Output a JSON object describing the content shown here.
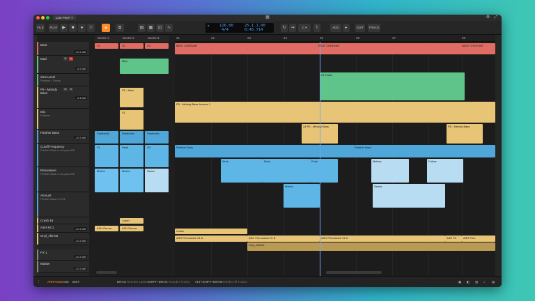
{
  "window": {
    "title": "Lost Peer*",
    "logo": "▦"
  },
  "toolbar": {
    "file": "FILE",
    "play": "PLAY",
    "play_icon": "▶",
    "stop_icon": "■",
    "record_icon": "●",
    "add_icon": "+",
    "tempo": "126.00",
    "signature": "4/4",
    "position": "25.1.1.00",
    "time": "0:45.714",
    "key": "C",
    "adg": "ADG",
    "edit": "EDIT",
    "track": "TRACK"
  },
  "scenes": [
    "Scene 1",
    "Scene 2",
    "Scene 3"
  ],
  "ruler": [
    "21",
    "22",
    "23",
    "24",
    "25",
    "26",
    "27",
    "28"
  ],
  "tracks": [
    {
      "name": "Beat",
      "db": "-10.0 dB",
      "color": "#e06c63"
    },
    {
      "name": "Mad",
      "db": "-6.0 dB",
      "color": "#5fc48a"
    },
    {
      "name": "Sine Level",
      "sub": "Polysine • Ocean",
      "color": "#5fc48a"
    },
    {
      "name": "P5 - Melody Bass",
      "db": "-6.8 dB",
      "color": "#e8c477"
    },
    {
      "name": "Mix",
      "sub": "Polysine",
      "color": "#e8c477"
    },
    {
      "name": "Panther Bass",
      "db": "-10.0 dB",
      "color": "#4fa6d8"
    },
    {
      "name": "Cutoff Frequency",
      "sub": "Panther Bass • Low-pass MS",
      "color": "#4fa6d8"
    },
    {
      "name": "Resonance",
      "sub": "Panther Bass • Low-pass MS",
      "color": "#4fa6d8"
    },
    {
      "name": "Amount",
      "sub": "Panther Bass • LFO1",
      "color": "#4fa6d8"
    },
    {
      "name": "Crash 16",
      "db": "",
      "color": "#e8c477"
    },
    {
      "name": "ASH Kit 1",
      "db": "-10.0 dB",
      "color": "#e8c477"
    },
    {
      "name": "vinyl_chirr02",
      "db": "-10.0 dB",
      "color": "#e8c477"
    },
    {
      "name": "FX 1",
      "db": "-10.0 dB",
      "color": "#888888"
    },
    {
      "name": "Master",
      "db": "-10.0 dB",
      "color": "#888888"
    }
  ],
  "launcher_clips": {
    "beat": [
      "S1",
      "S2",
      "S3"
    ],
    "mad": "Mad",
    "p5": "P5 - Melo",
    "s1": "S1",
    "panther": [
      "Panther9c",
      "Panther9c",
      "Panther9c"
    ],
    "sub": [
      "S1",
      "Peak",
      "S3"
    ],
    "res": [
      "Motion",
      "Motion",
      "Sewer"
    ],
    "crash": "Crash",
    "ash": [
      "ASH Perma",
      "ASH Perma"
    ]
  },
  "arranger_clips": {
    "beat": [
      "BEAT CHEEVAR",
      "BEAT CHEEVAR",
      "BEAT CHEEVAR"
    ],
    "mad": "21 Chain",
    "p5": "P5 - Melody Bass-Inverse 1",
    "p5b": [
      "24 P5 - Melody Bass",
      "P5 - Melody Bass"
    ],
    "panther": [
      "Panther Bass",
      "Panther Bass"
    ],
    "panther_sub": [
      "Mute",
      "Mute",
      "Peak",
      "Mellow",
      "Follow"
    ],
    "res": [
      "Motion",
      "Sewer"
    ],
    "crash": "Crash",
    "ash": [
      "ASH Percussion 01 A",
      "ASH Percussion 01 B",
      "ASH Percussion 01 A",
      "ASH Pe",
      "ASH Perc"
    ],
    "vinyl": "vinyl_chirr02"
  },
  "bottom": {
    "arrange": "ARRANGE",
    "mix": "MIX",
    "edit": "EDIT",
    "drag": "DRAG",
    "drag_desc": "Reorder Lanes",
    "shift_drag": "SHIFT+DRAG",
    "shift_drag_desc": "Reorder Tracks",
    "alt_drag": "ALT+SHIFT+DRAG",
    "alt_drag_desc": "Reorder All Tracks"
  }
}
